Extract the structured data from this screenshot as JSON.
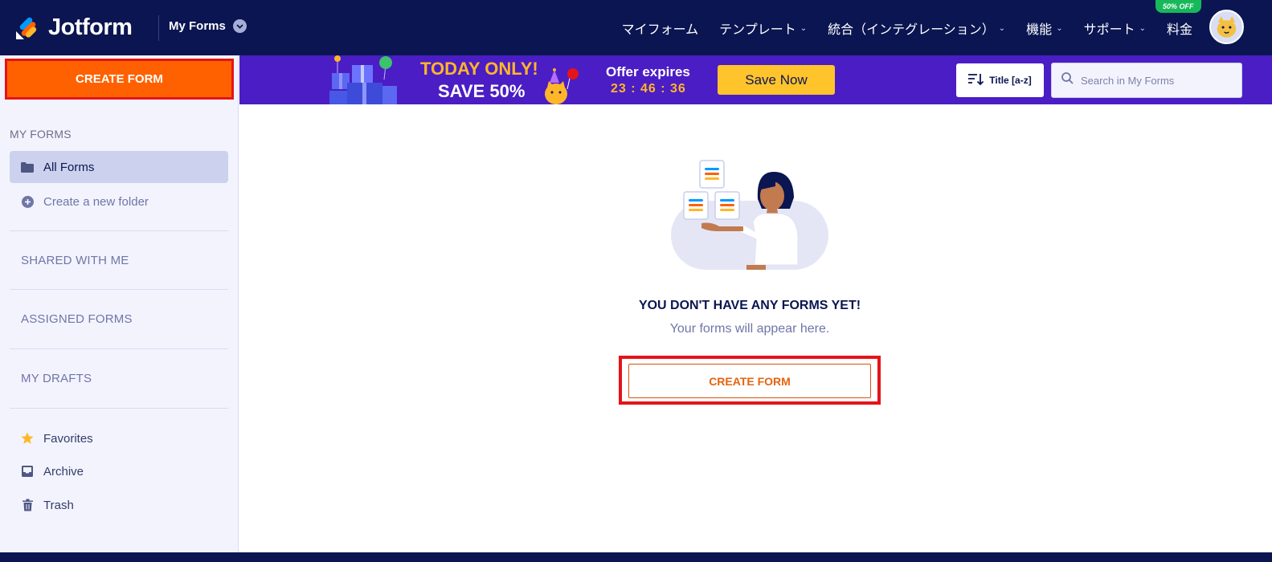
{
  "topnav": {
    "logo_text": "Jotform",
    "forms_switch_label": "My Forms",
    "links": [
      {
        "label": "マイフォーム",
        "has_chevron": false
      },
      {
        "label": "テンプレート",
        "has_chevron": true
      },
      {
        "label": "統合（インテグレーション）",
        "has_chevron": true
      },
      {
        "label": "機能",
        "has_chevron": true
      },
      {
        "label": "サポート",
        "has_chevron": true
      },
      {
        "label": "料金",
        "has_chevron": false
      }
    ],
    "promo_badge": "50% OFF"
  },
  "sidebar": {
    "create_button": "CREATE FORM",
    "heading": "MY FORMS",
    "all_forms": "All Forms",
    "new_folder": "Create a new folder",
    "sections": {
      "shared": "SHARED WITH ME",
      "assigned": "ASSIGNED FORMS",
      "drafts": "MY DRAFTS"
    },
    "bottom_items": {
      "favorites": "Favorites",
      "archive": "Archive",
      "trash": "Trash"
    }
  },
  "promo": {
    "today_only": "TODAY ONLY!",
    "save_text": "SAVE 50%",
    "offer_label": "Offer expires",
    "countdown": "23 : 46 : 36",
    "cta": "Save Now"
  },
  "toolbar": {
    "sort_label": "Title [a-z]",
    "search_placeholder": "Search in My Forms"
  },
  "empty_state": {
    "title": "YOU DON'T HAVE ANY FORMS YET!",
    "subtitle": "Your forms will appear here.",
    "cta": "CREATE FORM"
  },
  "colors": {
    "nav_bg": "#0a1551",
    "accent_orange": "#ff6100",
    "promo_purple": "#4b1dc4",
    "promo_yellow": "#ffb629",
    "highlight_red": "#e4141a"
  },
  "icons": [
    "jotform-logo-icon",
    "chevron-down-icon",
    "avatar-icon",
    "folder-icon",
    "plus-circle-icon",
    "star-icon",
    "archive-icon",
    "trash-icon",
    "sort-icon",
    "search-icon"
  ]
}
